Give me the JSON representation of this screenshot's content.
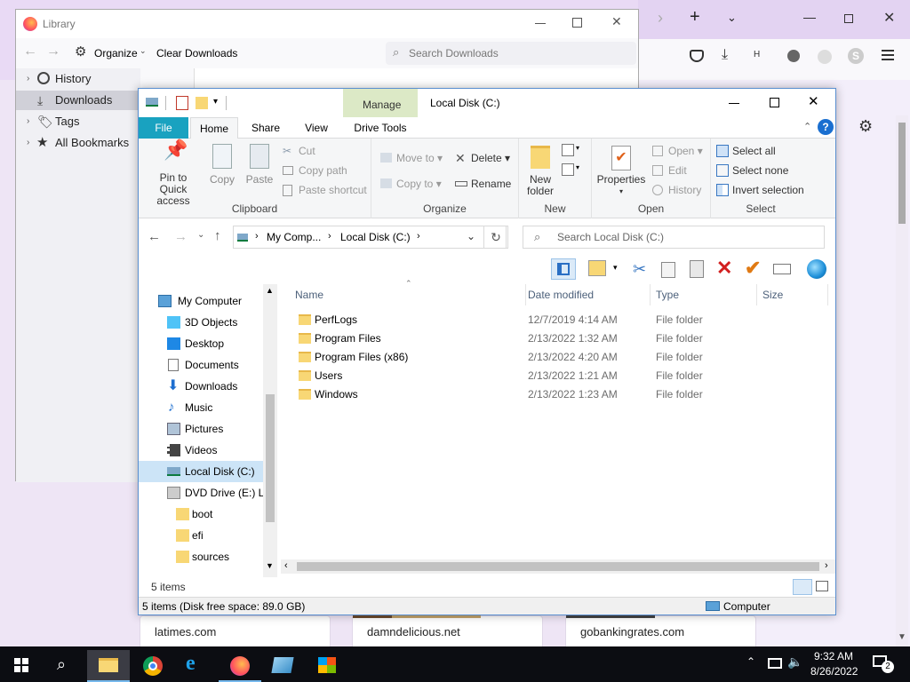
{
  "firefox": {
    "toolbar_icons": [
      "pocket-icon",
      "download-icon",
      "extension-icon",
      "privacy-icon",
      "sync-icon",
      "account-icon",
      "menu-icon"
    ],
    "tiles": [
      "latimes.com",
      "damndelicious.net",
      "gobankingrates.com"
    ]
  },
  "library": {
    "title": "Library",
    "organize_label": "Organize",
    "clear_downloads_label": "Clear Downloads",
    "search_placeholder": "Search Downloads",
    "sidebar": [
      {
        "label": "History",
        "icon": "clock-icon"
      },
      {
        "label": "Downloads",
        "icon": "download-icon",
        "selected": true
      },
      {
        "label": "Tags",
        "icon": "tag-icon"
      },
      {
        "label": "All Bookmarks",
        "icon": "star-icon"
      }
    ]
  },
  "explorer": {
    "title": "Local Disk (C:)",
    "manage_label": "Manage",
    "drive_tools_label": "Drive Tools",
    "tabs": [
      "File",
      "Home",
      "Share",
      "View"
    ],
    "ribbon": {
      "clipboard": {
        "label": "Clipboard",
        "pin": "Pin to Quick access",
        "copy": "Copy",
        "paste": "Paste",
        "cut": "Cut",
        "copy_path": "Copy path",
        "paste_shortcut": "Paste shortcut"
      },
      "organize": {
        "label": "Organize",
        "move_to": "Move to",
        "copy_to": "Copy to",
        "delete": "Delete",
        "rename": "Rename"
      },
      "new": {
        "label": "New",
        "new_folder": "New folder"
      },
      "open": {
        "label": "Open",
        "properties": "Properties",
        "open": "Open",
        "edit": "Edit",
        "history": "History"
      },
      "select": {
        "label": "Select",
        "select_all": "Select all",
        "select_none": "Select none",
        "invert": "Invert selection"
      }
    },
    "address": {
      "crumb1": "My Comp...",
      "crumb2": "Local Disk (C:)"
    },
    "search_placeholder": "Search Local Disk (C:)",
    "tree": [
      {
        "label": "My Computer",
        "icon": "computer-icon"
      },
      {
        "label": "3D Objects",
        "icon": "cube-icon"
      },
      {
        "label": "Desktop",
        "icon": "desktop-icon"
      },
      {
        "label": "Documents",
        "icon": "document-icon"
      },
      {
        "label": "Downloads",
        "icon": "download-arrow-icon"
      },
      {
        "label": "Music",
        "icon": "music-icon"
      },
      {
        "label": "Pictures",
        "icon": "picture-icon"
      },
      {
        "label": "Videos",
        "icon": "video-icon"
      },
      {
        "label": "Local Disk (C:)",
        "icon": "drive-icon",
        "selected": true
      },
      {
        "label": "DVD Drive (E:) LF",
        "icon": "dvd-icon"
      },
      {
        "label": "boot",
        "icon": "folder-icon"
      },
      {
        "label": "efi",
        "icon": "folder-icon"
      },
      {
        "label": "sources",
        "icon": "folder-icon"
      }
    ],
    "columns": [
      "Name",
      "Date modified",
      "Type",
      "Size"
    ],
    "files": [
      {
        "name": "PerfLogs",
        "date": "12/7/2019 4:14 AM",
        "type": "File folder"
      },
      {
        "name": "Program Files",
        "date": "2/13/2022 1:32 AM",
        "type": "File folder"
      },
      {
        "name": "Program Files (x86)",
        "date": "2/13/2022 4:20 AM",
        "type": "File folder"
      },
      {
        "name": "Users",
        "date": "2/13/2022 1:21 AM",
        "type": "File folder"
      },
      {
        "name": "Windows",
        "date": "2/13/2022 1:23 AM",
        "type": "File folder"
      }
    ],
    "item_count": "5 items",
    "status_left": "5 items (Disk free space: 89.0 GB)",
    "status_right": "Computer"
  },
  "taskbar": {
    "time": "9:32 AM",
    "date": "8/26/2022",
    "notification_count": "2"
  }
}
